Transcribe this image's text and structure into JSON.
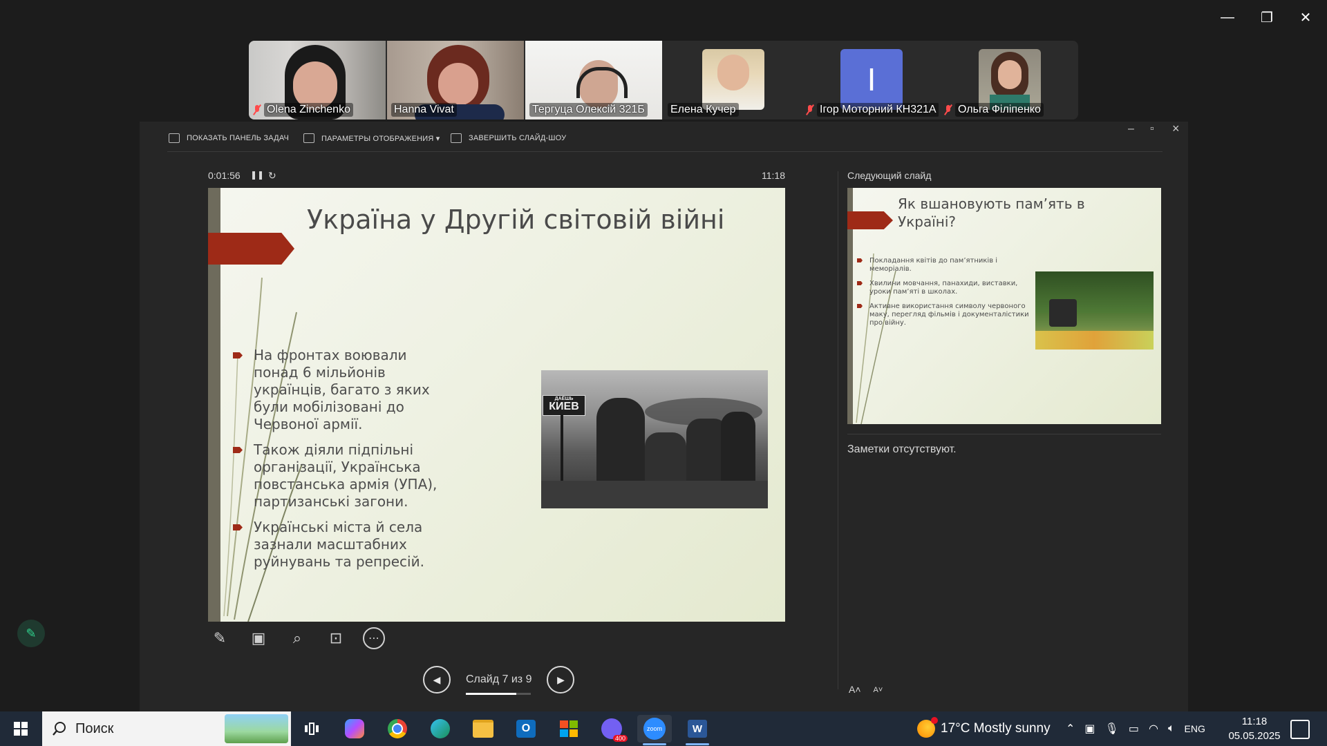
{
  "window": {
    "minimize": "—",
    "restore": "❐",
    "close": "✕"
  },
  "participants": [
    {
      "name": "Olena Zinchenko",
      "muted": true
    },
    {
      "name": "Hanna Vivat",
      "muted": false
    },
    {
      "name": "Тергуца Олексій 321Б",
      "muted": false,
      "active": true
    },
    {
      "name": "Елена Кучер",
      "muted": false
    },
    {
      "name": "Ігор Моторний КН321А",
      "muted": true,
      "initial": "I"
    },
    {
      "name": "Ольга Філіпенко",
      "muted": true
    }
  ],
  "presenter": {
    "toolbar": {
      "taskbar": "ПОКАЗАТЬ ПАНЕЛЬ ЗАДАЧ",
      "display": "ПАРАМЕТРЫ ОТОБРАЖЕНИЯ ▾",
      "end": "ЗАВЕРШИТЬ СЛАЙД-ШОУ"
    },
    "window_min": "–",
    "window_max": "▫",
    "window_close": "×",
    "elapsed": "0:01:56",
    "pause": "❚❚",
    "reset": "↻",
    "clock": "11:18",
    "slide": {
      "title": "Україна у Другій світовій війні",
      "bullets": [
        "На фронтах воювали понад 6 мільйонів українців, багато з яких були мобілізовані до Червоної армії.",
        "Також діяли підпільні організації, Українська повстанська армія (УПА), партизанські загони.",
        "Українські міста й села зазнали масштабних руйнувань та репресій."
      ],
      "sign_small": "ДАЁШЬ",
      "sign_big": "КИЕВ"
    },
    "tools": [
      "pen-icon",
      "grid-icon",
      "magnifier-icon",
      "pointer-screen-icon",
      "more-icon"
    ],
    "tool_glyphs": [
      "✎",
      "▣",
      "⌕",
      "⊡",
      "⋯"
    ],
    "nav": {
      "prev": "◀",
      "next": "▶",
      "counter": "Слайд 7 из 9",
      "progress": 0.7778
    },
    "next_label": "Следующий слайд",
    "next_slide": {
      "title": "Як вшановують пам’ять в Україні?",
      "bullets": [
        "Покладання квітів до пам’ятників і меморіалів.",
        "Хвилини мовчання, панахиди, виставки, уроки пам’яті в школах.",
        "Активне використання символу червоного маку, перегляд фільмів і документалістики про війну."
      ]
    },
    "notes": "Заметки отсутствуют.",
    "font_up": "A˄",
    "font_down": "A˅"
  },
  "taskbar": {
    "search_label": "Поиск",
    "mail_badge": "400",
    "weather": "17°C  Mostly sunny",
    "lang": "ENG",
    "time": "11:18",
    "date": "05.05.2025"
  }
}
